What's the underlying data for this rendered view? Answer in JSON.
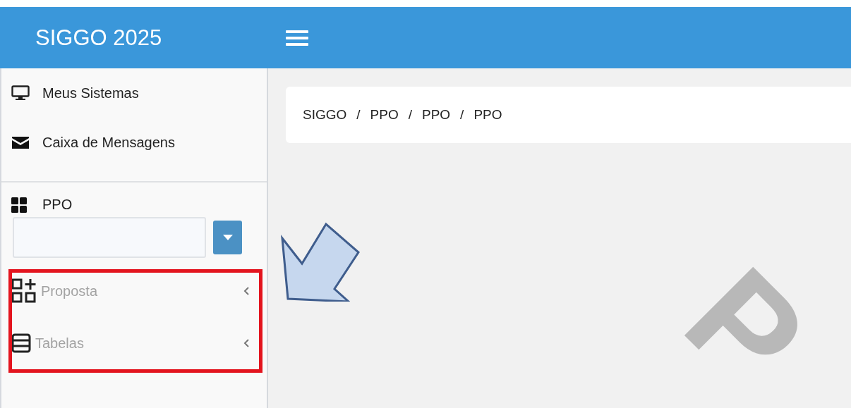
{
  "header": {
    "brand": "SIGGO 2025"
  },
  "sidebar": {
    "links": [
      {
        "label": "Meus Sistemas"
      },
      {
        "label": "Caixa de Mensagens"
      }
    ],
    "module": {
      "label": "PPO"
    },
    "menu": [
      {
        "label": "Proposta",
        "expanded": false
      },
      {
        "label": "Tabelas",
        "expanded": false
      }
    ]
  },
  "breadcrumb": {
    "separator": "/",
    "items": [
      "SIGGO",
      "PPO",
      "PPO",
      "PPO"
    ]
  },
  "background_mark": "P"
}
